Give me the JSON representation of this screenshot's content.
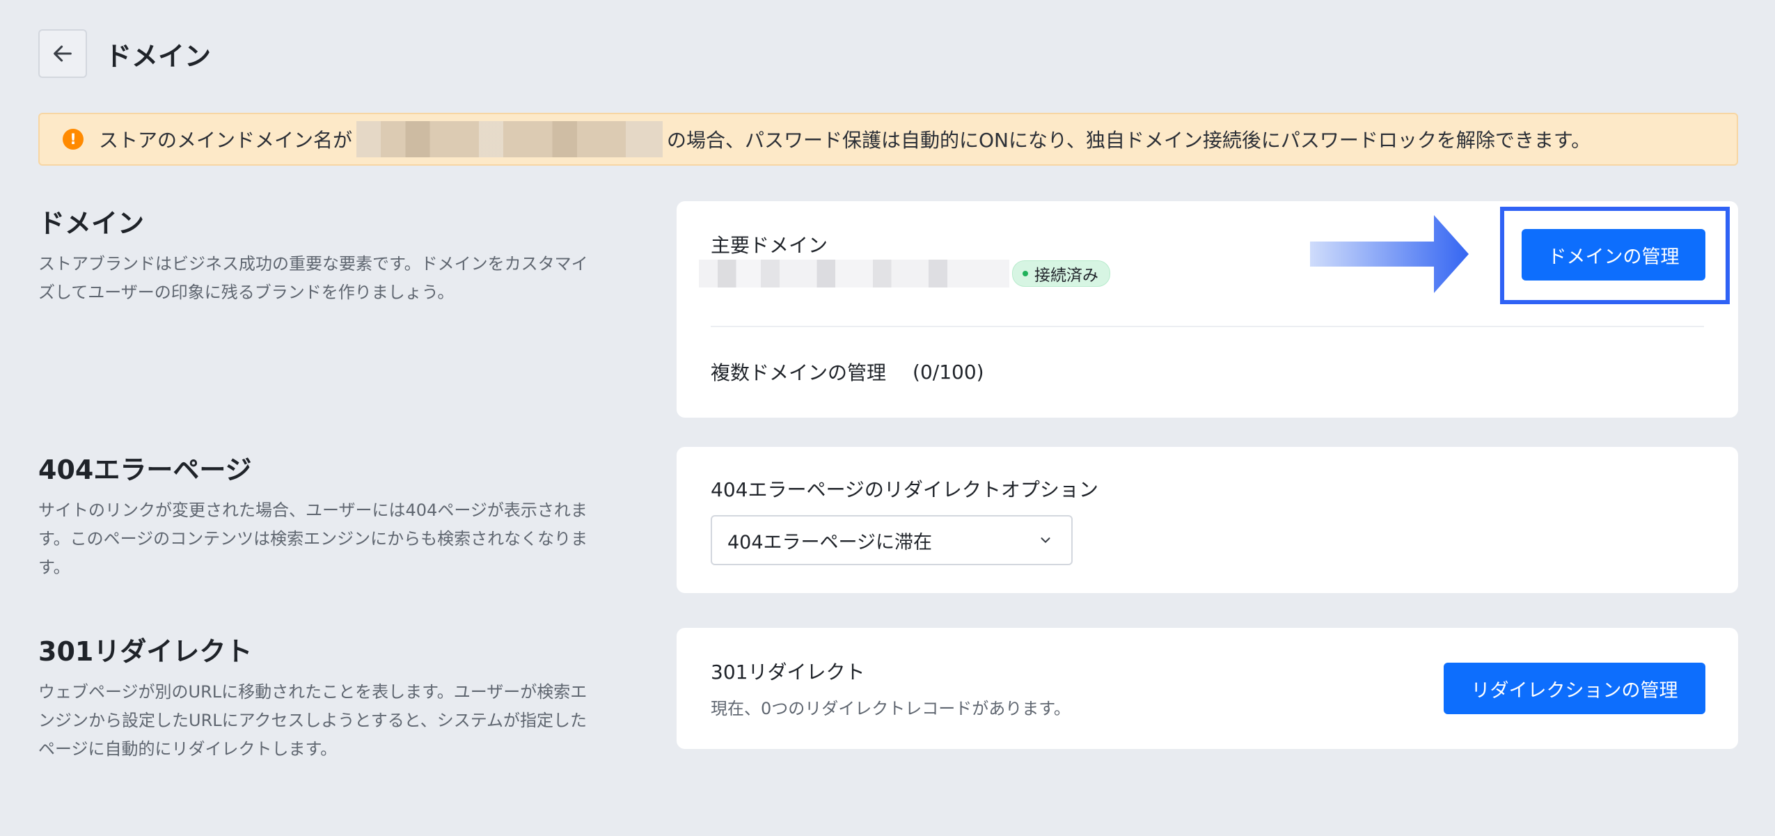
{
  "header": {
    "title": "ドメイン"
  },
  "notice": {
    "text_before": "ストアのメインドメイン名が",
    "text_after": "の場合、パスワード保護は自動的にONになり、独自ドメイン接続後にパスワードロックを解除できます。"
  },
  "domain_section": {
    "title": "ドメイン",
    "description": "ストアブランドはビジネス成功の重要な要素です。ドメインをカスタマイズしてユーザーの印象に残るブランドを作りましょう。",
    "primary_label": "主要ドメイン",
    "status_badge": "接続済み",
    "manage_button": "ドメインの管理",
    "multi_label": "複数ドメインの管理",
    "multi_count": "(0/100)"
  },
  "error_section": {
    "title": "404エラーページ",
    "description": "サイトのリンクが変更された場合、ユーザーには404ページが表示されます。このページのコンテンツは検索エンジンにからも検索されなくなります。",
    "option_label": "404エラーページのリダイレクトオプション",
    "selected_option": "404エラーページに滞在"
  },
  "redirect_section": {
    "title": "301リダイレクト",
    "description": "ウェブページが別のURLに移動されたことを表します。ユーザーが検索エンジンから設定したURLにアクセスしようとすると、システムが指定したページに自動的にリダイレクトします。",
    "card_title": "301リダイレクト",
    "card_subtext": "現在、0つのリダイレクトレコードがあります。",
    "manage_button": "リダイレクションの管理"
  },
  "colors": {
    "accent": "#0d6efd",
    "highlight_box": "#2f62f5",
    "notice_bg": "#fde9c8",
    "success": "#20b15a"
  },
  "icons": {
    "back": "arrow-left-icon",
    "warning": "exclamation-circle-icon",
    "dropdown": "chevron-down-icon",
    "annotation": "arrow-right-icon"
  }
}
